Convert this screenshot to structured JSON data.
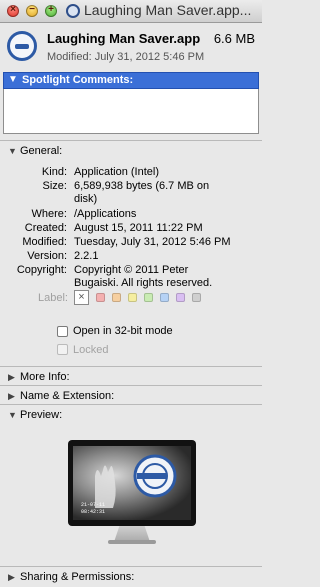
{
  "window": {
    "title": "Laughing Man Saver.app..."
  },
  "header": {
    "name": "Laughing Man Saver.app",
    "size": "6.6 MB",
    "modified": "Modified: July 31, 2012 5:46 PM"
  },
  "spotlight": {
    "label": "Spotlight Comments:",
    "value": ""
  },
  "general": {
    "label": "General:",
    "rows": [
      {
        "key": "Kind:",
        "value": "Application (Intel)"
      },
      {
        "key": "Size:",
        "value": "6,589,938 bytes (6.7 MB on",
        "value2": "disk)"
      },
      {
        "key": "Where:",
        "value": "/Applications"
      },
      {
        "key": "Created:",
        "value": "August 15, 2011 11:22 PM"
      },
      {
        "key": "Modified:",
        "value": "Tuesday, July 31, 2012 5:46 PM"
      },
      {
        "key": "Version:",
        "value": "2.2.1"
      },
      {
        "key": "Copyright:",
        "value": "Copyright © 2011 Peter",
        "value2": "Bugaiski. All rights reserved."
      }
    ],
    "label_caption": "Label:",
    "label_colors": [
      "#f4b0b0",
      "#f6cfa0",
      "#f5eea0",
      "#c9ecb3",
      "#b6d2f5",
      "#d9bff2",
      "#cfcfcf"
    ],
    "open32": "Open in 32-bit mode",
    "locked": "Locked"
  },
  "sections": {
    "more_info": "More Info:",
    "name_ext": "Name & Extension:",
    "preview": "Preview:",
    "sharing": "Sharing & Permissions:"
  },
  "preview_overlay": {
    "line1": "21-07-11",
    "line2": "08:42:31"
  }
}
